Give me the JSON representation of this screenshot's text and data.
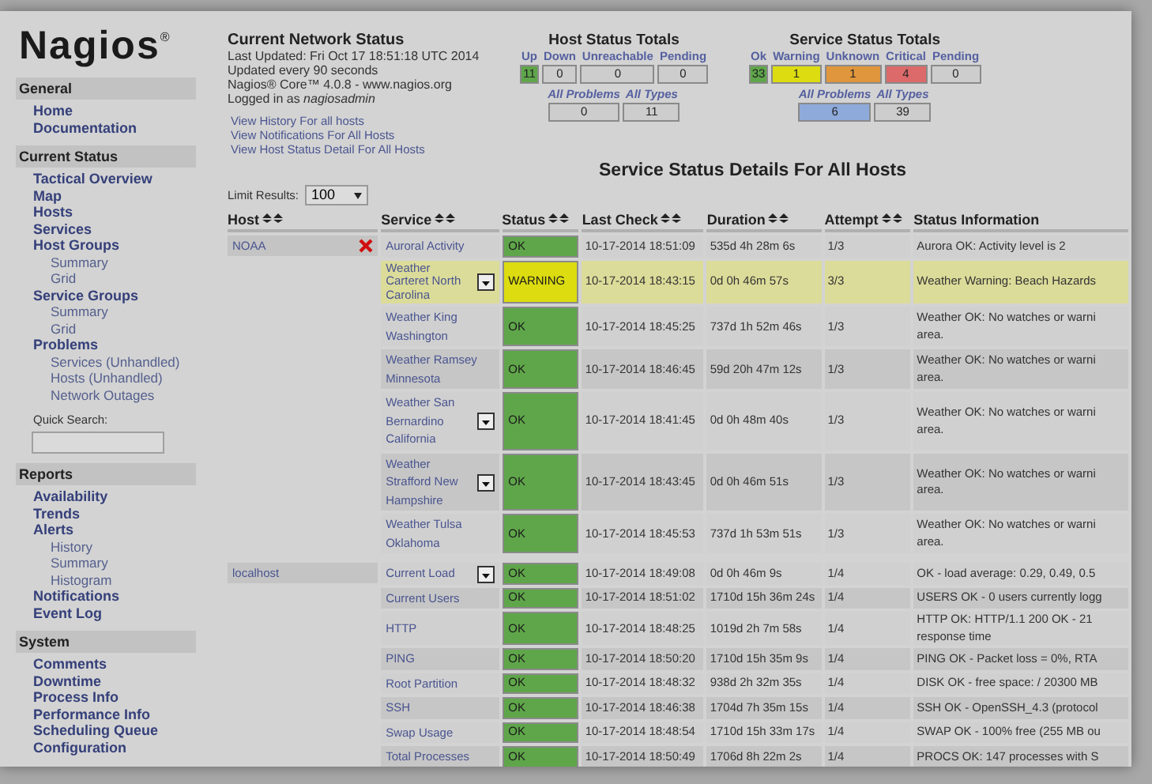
{
  "logo": "Nagios",
  "logo_mark": "®",
  "sidebar": [
    {
      "heading": "General",
      "items": [
        {
          "label": "Home"
        },
        {
          "label": "Documentation"
        }
      ]
    },
    {
      "heading": "Current Status",
      "items": [
        {
          "label": "Tactical Overview"
        },
        {
          "label": "Map"
        },
        {
          "label": "Hosts"
        },
        {
          "label": "Services"
        },
        {
          "label": "Host Groups",
          "children": [
            {
              "label": "Summary"
            },
            {
              "label": "Grid"
            }
          ]
        },
        {
          "label": "Service Groups",
          "children": [
            {
              "label": "Summary"
            },
            {
              "label": "Grid"
            }
          ]
        },
        {
          "label": "Problems",
          "children": [
            {
              "label": "Services (Unhandled)"
            },
            {
              "label": "Hosts (Unhandled)"
            },
            {
              "label": "Network Outages"
            }
          ]
        }
      ],
      "search_label": "Quick Search:"
    },
    {
      "heading": "Reports",
      "items": [
        {
          "label": "Availability"
        },
        {
          "label": "Trends"
        },
        {
          "label": "Alerts",
          "children": [
            {
              "label": "History"
            },
            {
              "label": "Summary"
            },
            {
              "label": "Histogram"
            }
          ]
        },
        {
          "label": "Notifications"
        },
        {
          "label": "Event Log"
        }
      ]
    },
    {
      "heading": "System",
      "items": [
        {
          "label": "Comments"
        },
        {
          "label": "Downtime"
        },
        {
          "label": "Process Info"
        },
        {
          "label": "Performance Info"
        },
        {
          "label": "Scheduling Queue"
        },
        {
          "label": "Configuration"
        }
      ]
    }
  ],
  "status_info": {
    "title": "Current Network Status",
    "lines": [
      "Last Updated: Fri Oct 17 18:51:18 UTC 2014",
      "Updated every 90 seconds",
      "Nagios® Core™ 4.0.8 - www.nagios.org"
    ],
    "logged_in": "Logged in as *nagiosadmin*",
    "links": [
      "View History For all hosts",
      "View Notifications For All Hosts",
      "View Host Status Detail For All Hosts"
    ]
  },
  "host_totals": {
    "title": "Host Status Totals",
    "items": [
      {
        "label": "Up",
        "value": "11",
        "kind": "ok"
      },
      {
        "label": "Down",
        "value": "0",
        "kind": "none"
      },
      {
        "label": "Unreachable",
        "value": "0",
        "kind": "none"
      },
      {
        "label": "Pending",
        "value": "0",
        "kind": "none"
      }
    ],
    "summary": [
      {
        "label": "All Problems",
        "value": "0",
        "kind": "none"
      },
      {
        "label": "All Types",
        "value": "11",
        "kind": "none"
      }
    ]
  },
  "service_totals": {
    "title": "Service Status Totals",
    "items": [
      {
        "label": "Ok",
        "value": "33",
        "kind": "ok"
      },
      {
        "label": "Warning",
        "value": "1",
        "kind": "warning"
      },
      {
        "label": "Unknown",
        "value": "1",
        "kind": "unknown"
      },
      {
        "label": "Critical",
        "value": "4",
        "kind": "critical"
      },
      {
        "label": "Pending",
        "value": "0",
        "kind": "none"
      }
    ],
    "summary": [
      {
        "label": "All Problems",
        "value": "6",
        "kind": "problems"
      },
      {
        "label": "All Types",
        "value": "39",
        "kind": "none"
      }
    ]
  },
  "page_title": "Service Status Details For All Hosts",
  "limit": {
    "label": "Limit Results:",
    "value": "100"
  },
  "table": {
    "columns": [
      "Host",
      "Service",
      "Status",
      "Last Check",
      "Duration",
      "Attempt",
      "Status Information"
    ],
    "sortable": [
      true,
      true,
      true,
      true,
      true,
      true,
      false
    ],
    "groups": [
      {
        "host": "NOAA",
        "notifications_disabled": true,
        "rows": [
          {
            "service": "Auroral Activity",
            "menu": false,
            "status": "OK",
            "kind": "ok",
            "last_check": "10-17-2014 18:51:09",
            "duration": "535d 4h 28m 6s",
            "attempt": "1/3",
            "info": [
              "Aurora OK: Activity level is 2"
            ]
          },
          {
            "service": "Weather Carteret North Carolina",
            "menu": true,
            "status": "WARNING",
            "kind": "warning",
            "last_check": "10-17-2014 18:43:15",
            "duration": "0d 0h 46m 57s",
            "attempt": "3/3",
            "info": [
              "Weather Warning: Beach Hazards"
            ]
          },
          {
            "service": "Weather King Washington",
            "menu": false,
            "status": "OK",
            "kind": "ok",
            "last_check": "10-17-2014 18:45:25",
            "duration": "737d 1h 52m 46s",
            "attempt": "1/3",
            "info": [
              "Weather OK: No watches or warni",
              "area."
            ]
          },
          {
            "service": "Weather Ramsey Minnesota",
            "menu": false,
            "status": "OK",
            "kind": "ok",
            "last_check": "10-17-2014 18:46:45",
            "duration": "59d 20h 47m 12s",
            "attempt": "1/3",
            "info": [
              "Weather OK: No watches or warni",
              "area."
            ]
          },
          {
            "service": "Weather San Bernardino California",
            "menu": true,
            "status": "OK",
            "kind": "ok",
            "last_check": "10-17-2014 18:41:45",
            "duration": "0d 0h 48m 40s",
            "attempt": "1/3",
            "info": [
              "Weather OK: No watches or warni",
              "area."
            ]
          },
          {
            "service": "Weather Strafford New Hampshire",
            "menu": true,
            "status": "OK",
            "kind": "ok",
            "last_check": "10-17-2014 18:43:45",
            "duration": "0d 0h 46m 51s",
            "attempt": "1/3",
            "info": [
              "Weather OK: No watches or warni",
              "area."
            ]
          },
          {
            "service": "Weather Tulsa Oklahoma",
            "menu": false,
            "status": "OK",
            "kind": "ok",
            "last_check": "10-17-2014 18:45:53",
            "duration": "737d 1h 53m 51s",
            "attempt": "1/3",
            "info": [
              "Weather OK: No watches or warni",
              "area."
            ]
          }
        ]
      },
      {
        "host": "localhost",
        "notifications_disabled": false,
        "rows": [
          {
            "service": "Current Load",
            "menu": true,
            "status": "OK",
            "kind": "ok",
            "last_check": "10-17-2014 18:49:08",
            "duration": "0d 0h 46m 9s",
            "attempt": "1/4",
            "info": [
              "OK - load average: 0.29, 0.49, 0.5"
            ]
          },
          {
            "service": "Current Users",
            "menu": false,
            "status": "OK",
            "kind": "ok",
            "last_check": "10-17-2014 18:51:02",
            "duration": "1710d 15h 36m 24s",
            "attempt": "1/4",
            "info": [
              "USERS OK - 0 users currently logg"
            ]
          },
          {
            "service": "HTTP",
            "menu": false,
            "status": "OK",
            "kind": "ok",
            "last_check": "10-17-2014 18:48:25",
            "duration": "1019d 2h 7m 58s",
            "attempt": "1/4",
            "info": [
              "HTTP OK: HTTP/1.1 200 OK - 21",
              "response time"
            ]
          },
          {
            "service": "PING",
            "menu": false,
            "status": "OK",
            "kind": "ok",
            "last_check": "10-17-2014 18:50:20",
            "duration": "1710d 15h 35m 9s",
            "attempt": "1/4",
            "info": [
              "PING OK - Packet loss = 0%, RTA"
            ]
          },
          {
            "service": "Root Partition",
            "menu": false,
            "status": "OK",
            "kind": "ok",
            "last_check": "10-17-2014 18:48:32",
            "duration": "938d 2h 32m 35s",
            "attempt": "1/4",
            "info": [
              "DISK OK - free space: / 20300 MB"
            ]
          },
          {
            "service": "SSH",
            "menu": false,
            "status": "OK",
            "kind": "ok",
            "last_check": "10-17-2014 18:46:38",
            "duration": "1704d 7h 35m 15s",
            "attempt": "1/4",
            "info": [
              "SSH OK - OpenSSH_4.3 (protocol"
            ]
          },
          {
            "service": "Swap Usage",
            "menu": false,
            "status": "OK",
            "kind": "ok",
            "last_check": "10-17-2014 18:48:54",
            "duration": "1710d 15h 33m 17s",
            "attempt": "1/4",
            "info": [
              "SWAP OK - 100% free (255 MB ou"
            ]
          },
          {
            "service": "Total Processes",
            "menu": false,
            "status": "OK",
            "kind": "ok",
            "last_check": "10-17-2014 18:50:49",
            "duration": "1706d 8h 22m 2s",
            "attempt": "1/4",
            "info": [
              "PROCS OK: 147 processes with S"
            ]
          }
        ]
      }
    ]
  }
}
